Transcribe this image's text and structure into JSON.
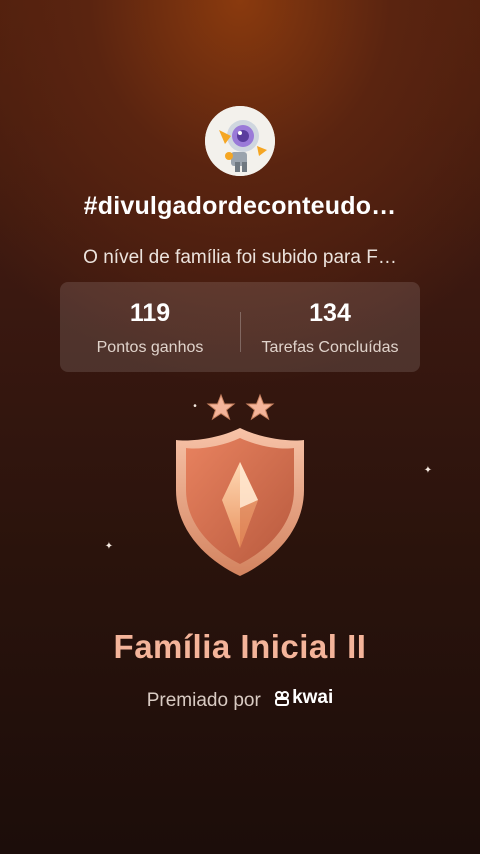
{
  "profile": {
    "username": "#divulgadordeconteudo…",
    "avatar_icon": "robot-avatar-icon"
  },
  "message": "O nível de família foi subido para F…",
  "stats": [
    {
      "value": "119",
      "label": "Pontos ganhos"
    },
    {
      "value": "134",
      "label": "Tarefas Concluídas"
    }
  ],
  "badge": {
    "stars": 2,
    "icon": "shield-badge-icon",
    "colors": {
      "shield": "#f0a987",
      "stars": "#f4b49a",
      "gem": "#e8925f"
    }
  },
  "level_title": "Família Inicial II",
  "awarded_by": {
    "prefix": "Premiado por",
    "brand": "kwai",
    "brand_icon": "kwai-logo-icon"
  }
}
